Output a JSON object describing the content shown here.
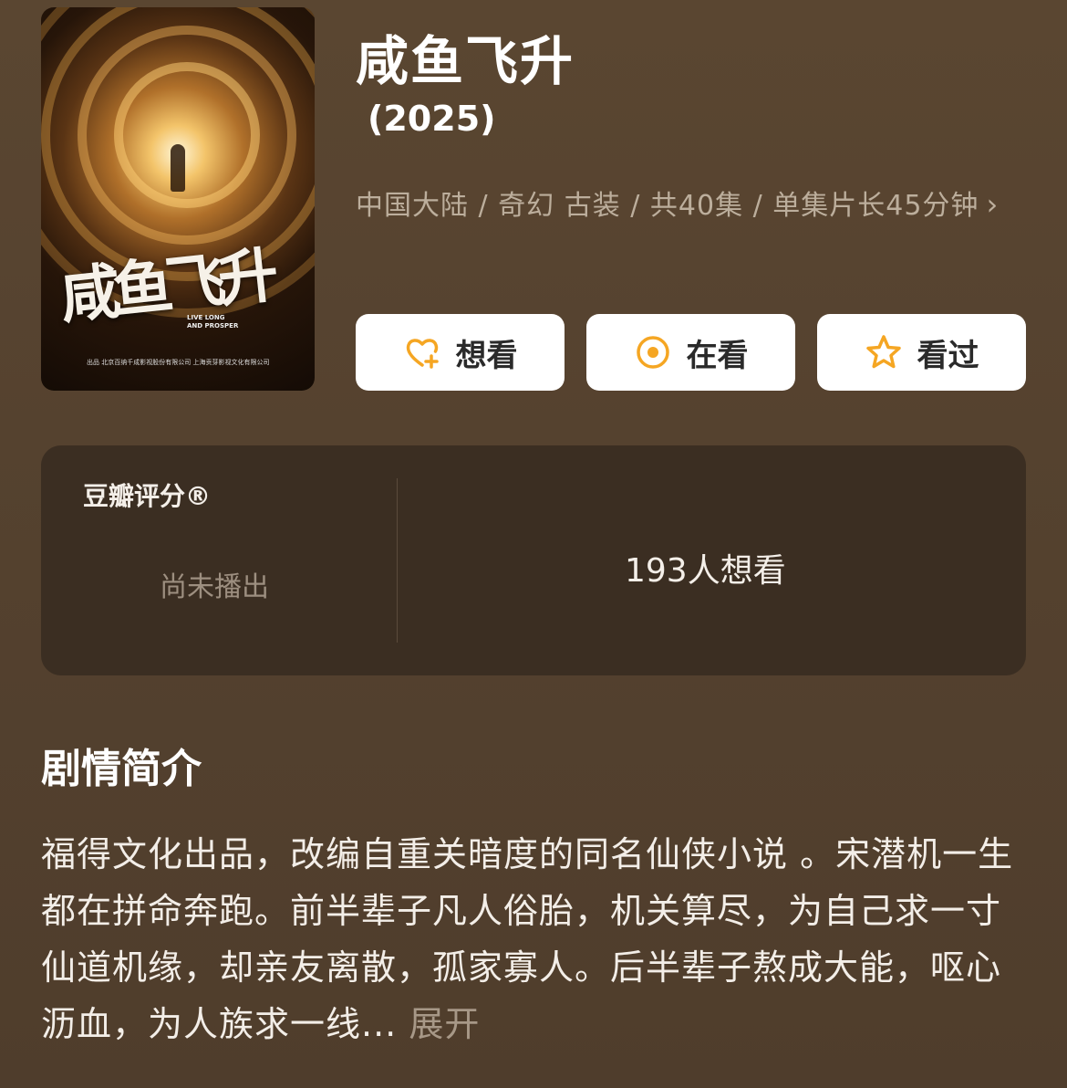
{
  "poster": {
    "calligraphy_title": "咸鱼飞升",
    "english_title": [
      "LIVE LONG",
      "AND PROSPER"
    ],
    "credits": "出品 北京百纳千成影视股份有限公司 上海贡芽影视文化有限公司"
  },
  "title": "咸鱼飞升",
  "year": "(2025)",
  "meta": "中国大陆 / 奇幻 古装 / 共40集 / 单集片长45分钟",
  "meta_chevron": "›",
  "buttons": [
    {
      "label": "想看",
      "icon": "heart-plus-icon"
    },
    {
      "label": "在看",
      "icon": "target-circle-icon"
    },
    {
      "label": "看过",
      "icon": "star-outline-icon"
    }
  ],
  "colors": {
    "accent": "#F5A623",
    "card_bg": "#3B2E22"
  },
  "rating": {
    "label": "豆瓣评分®",
    "status": "尚未播出",
    "want_count": "193人想看"
  },
  "synopsis": {
    "heading": "剧情简介",
    "text": "福得文化出品，改编自重关暗度的同名仙侠小说 。宋潜机一生都在拼命奔跑。前半辈子凡人俗胎，机关算尽，为自己求一寸仙道机缘，却亲友离散，孤家寡人。后半辈子熬成大能，呕心沥血，为人族求一线...",
    "expand": "展开"
  }
}
